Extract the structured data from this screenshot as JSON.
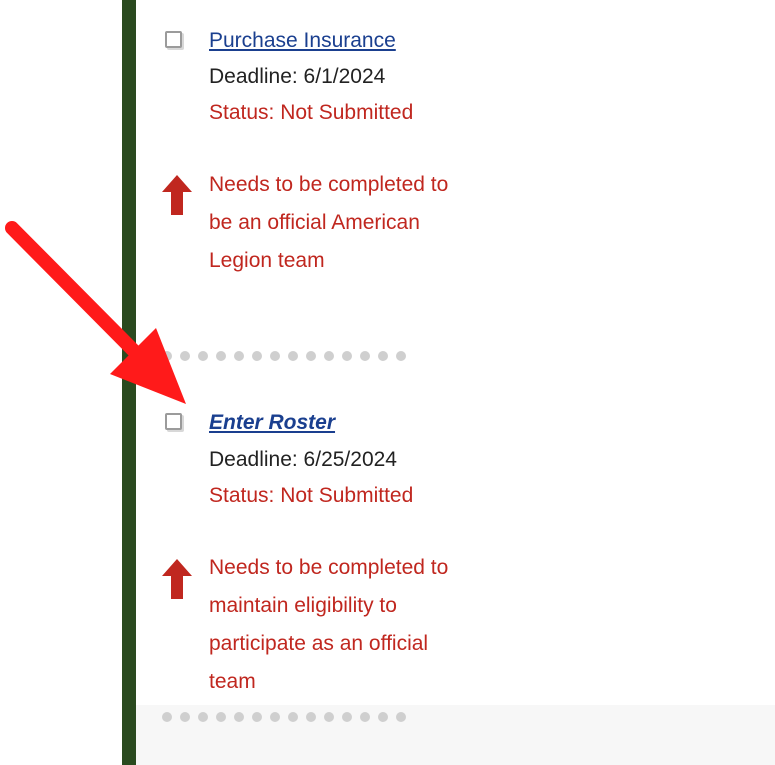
{
  "tasks": [
    {
      "title": "Purchase Insurance",
      "deadline": "Deadline: 6/1/2024",
      "status": "Status: Not Submitted",
      "requirement": "Needs to be completed to be an official American Legion team"
    },
    {
      "title": "Enter Roster",
      "deadline": "Deadline: 6/25/2024",
      "status": "Status: Not Submitted",
      "requirement": "Needs to be completed to maintain eligibility to participate as an official team"
    }
  ],
  "icons": {
    "checkbox": "checkbox-icon",
    "requirement": "red-up-arrow-icon",
    "annotation": "red-pointer-arrow-icon"
  },
  "colors": {
    "sidebar": "#2a4a1f",
    "link": "#1a3f8f",
    "alert": "#c0271f",
    "annotation_arrow": "#ff1a1a"
  }
}
